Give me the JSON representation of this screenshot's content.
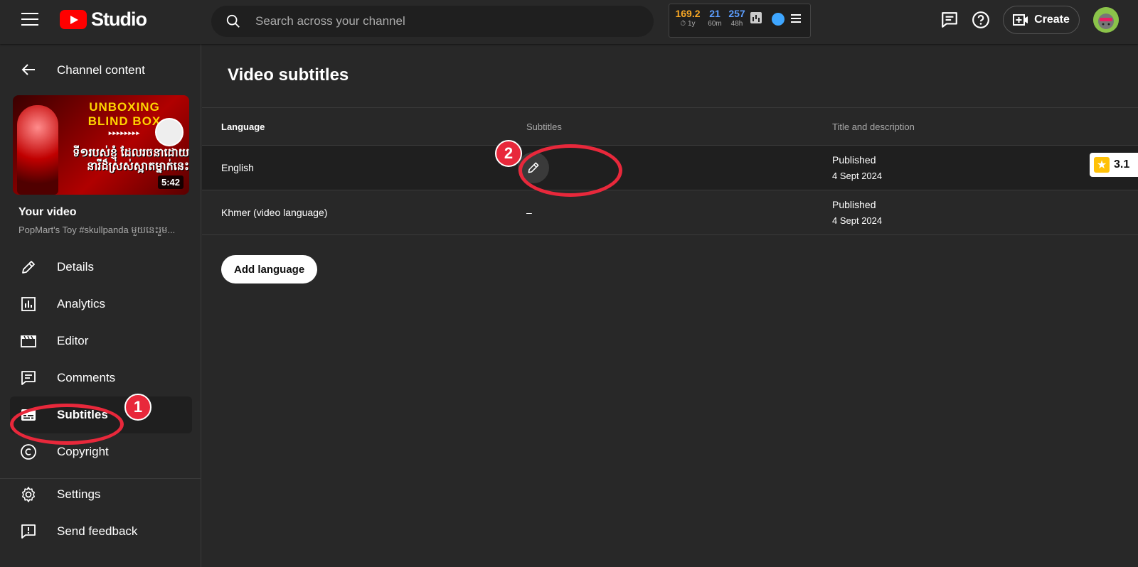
{
  "header": {
    "logo_text": "Studio",
    "search_placeholder": "Search across your channel",
    "create_label": "Create"
  },
  "extension": {
    "stats": [
      {
        "value": "169.2",
        "label": "⏱ 1y",
        "color": "#f9a825"
      },
      {
        "value": "21",
        "label": "60m",
        "color": "#5c9eff"
      },
      {
        "value": "257",
        "label": "48h",
        "color": "#5c9eff"
      }
    ]
  },
  "sidebar": {
    "back_label": "Channel content",
    "thumbnail": {
      "title_line1": "UNBOXING",
      "title_line2": "BLIND BOX",
      "arrows": "▸▸▸▸▸▸▸▸",
      "khmer_line1": "ទី១របស់ខ្ញុំ ដែលរចនាដោយ",
      "khmer_line2": "នារីដ៏ស្រស់ស្អាតម្នាក់នេះ",
      "duration": "5:42"
    },
    "your_video_label": "Your video",
    "video_name": "PopMart's Toy #skullpanda មួយនេះរួម...",
    "items": [
      {
        "label": "Details",
        "icon": "pencil-icon"
      },
      {
        "label": "Analytics",
        "icon": "analytics-icon"
      },
      {
        "label": "Editor",
        "icon": "clapperboard-icon"
      },
      {
        "label": "Comments",
        "icon": "comment-icon"
      },
      {
        "label": "Subtitles",
        "icon": "subtitles-icon",
        "active": true
      },
      {
        "label": "Copyright",
        "icon": "copyright-icon"
      },
      {
        "label": "Settings",
        "icon": "gear-icon"
      },
      {
        "label": "Send feedback",
        "icon": "feedback-icon"
      }
    ]
  },
  "main": {
    "title": "Video subtitles",
    "columns": [
      "Language",
      "Subtitles",
      "Title and description"
    ],
    "rows": [
      {
        "language": "English",
        "subtitles": "",
        "status": "Published",
        "date": "4 Sept 2024"
      },
      {
        "language": "Khmer (video language)",
        "subtitles": "–",
        "status": "Published",
        "date": "4 Sept 2024"
      }
    ],
    "add_language_label": "Add language"
  },
  "rating": {
    "value": "3.1",
    "star": "★"
  },
  "annotations": {
    "step1": "1",
    "step2": "2",
    "color": "#e8283b"
  }
}
